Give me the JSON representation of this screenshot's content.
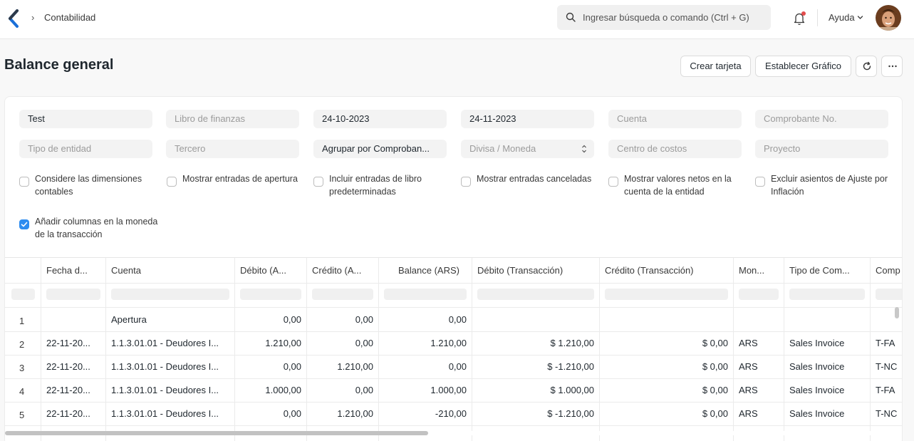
{
  "navbar": {
    "breadcrumb": "Contabilidad",
    "search_placeholder": "Ingresar búsqueda o comando (Ctrl + G)",
    "help_label": "Ayuda"
  },
  "page": {
    "title": "Balance general",
    "buttons": {
      "create_card": "Crear tarjeta",
      "set_chart": "Establecer Gráfico"
    }
  },
  "filters": {
    "company": "Test",
    "finance_book": "Libro de finanzas",
    "from_date": "24-10-2023",
    "to_date": "24-11-2023",
    "account": "Cuenta",
    "voucher_no": "Comprobante No.",
    "party_type": "Tipo de entidad",
    "party": "Tercero",
    "group_by": "Agrupar por Comproban...",
    "currency": "Divisa / Moneda",
    "cost_center": "Centro de costos",
    "project": "Proyecto"
  },
  "checkboxes": [
    {
      "label": "Considere las dimensiones contables",
      "checked": false
    },
    {
      "label": "Mostrar entradas de apertura",
      "checked": false
    },
    {
      "label": "Incluir entradas de libro predeterminadas",
      "checked": false
    },
    {
      "label": "Mostrar entradas canceladas",
      "checked": false
    },
    {
      "label": "Mostrar valores netos en la cuenta de la entidad",
      "checked": false
    },
    {
      "label": "Excluir asientos de Ajuste por Inflación",
      "checked": false
    },
    {
      "label": "Añadir columnas en la moneda de la transacción",
      "checked": true
    }
  ],
  "table": {
    "headers": [
      "Fecha d...",
      "Cuenta",
      "Débito (A...",
      "Crédito (A...",
      "Balance (ARS)",
      "Débito (Transacción)",
      "Crédito (Transacción)",
      "Mon...",
      "Tipo de Com...",
      "Comp"
    ],
    "rows": [
      {
        "n": "1",
        "date": "",
        "account": "Apertura",
        "debit": "0,00",
        "credit": "0,00",
        "balance": "0,00",
        "debit_tx": "",
        "credit_tx": "",
        "currency": "",
        "voucher_type": "",
        "voucher": ""
      },
      {
        "n": "2",
        "date": "22-11-20...",
        "account": "1.1.3.01.01 - Deudores I...",
        "debit": "1.210,00",
        "credit": "0,00",
        "balance": "1.210,00",
        "debit_tx": "$ 1.210,00",
        "credit_tx": "$ 0,00",
        "currency": "ARS",
        "voucher_type": "Sales Invoice",
        "voucher": "T-FA"
      },
      {
        "n": "3",
        "date": "22-11-20...",
        "account": "1.1.3.01.01 - Deudores I...",
        "debit": "0,00",
        "credit": "1.210,00",
        "balance": "0,00",
        "debit_tx": "$ -1.210,00",
        "credit_tx": "$ 0,00",
        "currency": "ARS",
        "voucher_type": "Sales Invoice",
        "voucher": "T-NC"
      },
      {
        "n": "4",
        "date": "22-11-20...",
        "account": "1.1.3.01.01 - Deudores I...",
        "debit": "1.000,00",
        "credit": "0,00",
        "balance": "1.000,00",
        "debit_tx": "$ 1.000,00",
        "credit_tx": "$ 0,00",
        "currency": "ARS",
        "voucher_type": "Sales Invoice",
        "voucher": "T-FA"
      },
      {
        "n": "5",
        "date": "22-11-20...",
        "account": "1.1.3.01.01 - Deudores I...",
        "debit": "0,00",
        "credit": "1.210,00",
        "balance": "-210,00",
        "debit_tx": "$ -1.210,00",
        "credit_tx": "$ 0,00",
        "currency": "ARS",
        "voucher_type": "Sales Invoice",
        "voucher": "T-NC"
      }
    ]
  }
}
